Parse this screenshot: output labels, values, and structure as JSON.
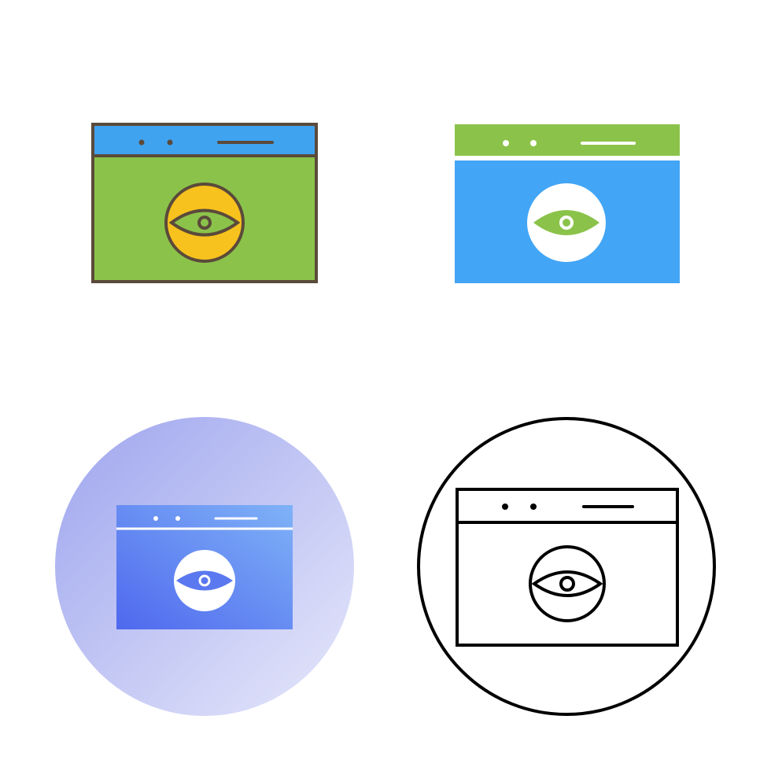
{
  "icons": [
    {
      "style": "filled-outline",
      "symbol": "browser-eye-icon",
      "colors": {
        "titlebar": "#3fa3f0",
        "body": "#8bc34a",
        "lens": "#f7c21d",
        "stroke": "#5b4a3a"
      }
    },
    {
      "style": "flat",
      "symbol": "browser-eye-icon",
      "colors": {
        "titlebar": "#8bc34a",
        "body": "#42a5f5",
        "lens": "#ffffff",
        "eye": "#8bc34a"
      }
    },
    {
      "style": "gradient",
      "symbol": "browser-eye-icon",
      "colors": {
        "backdrop_from": "#9ea5ee",
        "backdrop_to": "#e6e8fa",
        "window_from": "#4f68ee",
        "window_to": "#7fb2f7",
        "lens": "#ffffff"
      }
    },
    {
      "style": "line",
      "symbol": "browser-eye-icon",
      "colors": {
        "stroke": "#000000",
        "fill": "#ffffff"
      }
    }
  ]
}
